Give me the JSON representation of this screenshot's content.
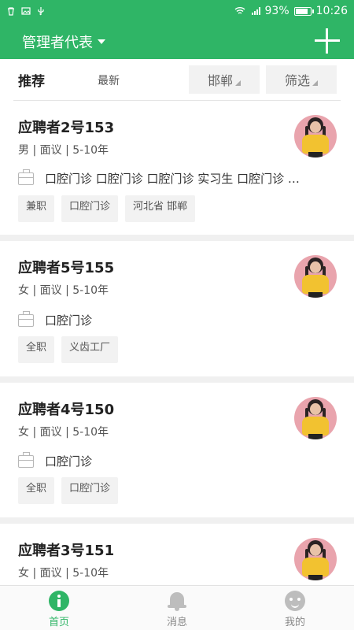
{
  "status_bar": {
    "battery": "93%",
    "battery_level": 0.93,
    "time": "10:26",
    "icons": [
      "trash-icon",
      "image-icon",
      "usb-icon",
      "wifi-icon",
      "signal-icon",
      "battery-icon"
    ]
  },
  "header": {
    "title": "管理者代表",
    "add_icon": "plus-icon",
    "accent_color": "#2fb566"
  },
  "filter_bar": {
    "tab_recommend": "推荐",
    "tab_latest": "最新",
    "city": "邯郸",
    "filter": "筛选"
  },
  "candidates": [
    {
      "name": "应聘者2号153",
      "gender": "男",
      "salary": "面议",
      "experience": "5-10年",
      "positions": "口腔门诊 口腔门诊 口腔门诊 实习生 口腔门诊 …",
      "tags": [
        "兼职",
        "口腔门诊",
        "河北省 邯郸"
      ]
    },
    {
      "name": "应聘者5号155",
      "gender": "女",
      "salary": "面议",
      "experience": "5-10年",
      "positions": "口腔门诊",
      "tags": [
        "全职",
        "义齿工厂"
      ]
    },
    {
      "name": "应聘者4号150",
      "gender": "女",
      "salary": "面议",
      "experience": "5-10年",
      "positions": "口腔门诊",
      "tags": [
        "全职",
        "口腔门诊"
      ]
    },
    {
      "name": "应聘者3号151",
      "gender": "女",
      "salary": "面议",
      "experience": "5-10年"
    }
  ],
  "bottom_nav": {
    "home": "首页",
    "messages": "消息",
    "me": "我的"
  }
}
